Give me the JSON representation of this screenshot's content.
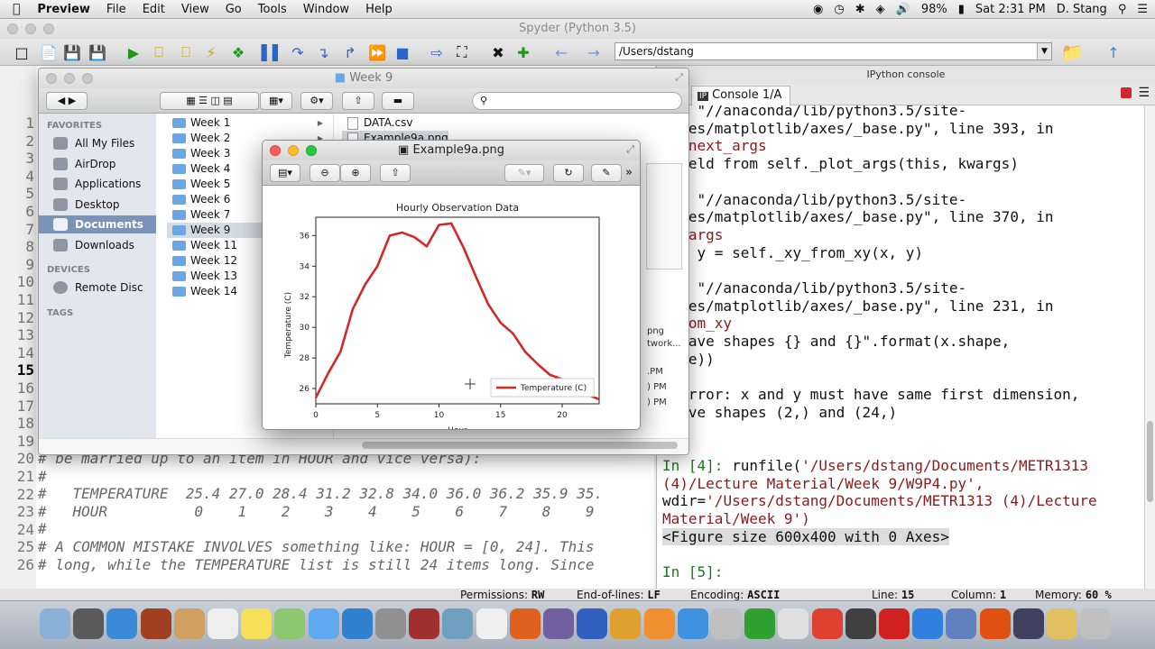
{
  "menubar": {
    "apple": "",
    "app": "Preview",
    "items": [
      "File",
      "Edit",
      "View",
      "Go",
      "Tools",
      "Window",
      "Help"
    ],
    "battery": "98%",
    "clock": "Sat 2:31 PM",
    "user": "D. Stang"
  },
  "spyder": {
    "title": "Spyder (Python 3.5)",
    "path": "/Users/dstang",
    "console_header": "IPython console",
    "console_tab": "Console 1/A"
  },
  "editor": {
    "line_numbers": [
      "1",
      "2",
      "3",
      "4",
      "5",
      "6",
      "7",
      "8",
      "9",
      "10",
      "11",
      "12",
      "13",
      "14",
      "15",
      "16",
      "17",
      "18",
      "19",
      "20",
      "21",
      "22",
      "23",
      "24",
      "25",
      "26"
    ],
    "current_line": "15",
    "code_lines": [
      "# be married up to an item in HOUR and vice versa):",
      "#",
      "#   TEMPERATURE  25.4 27.0 28.4 31.2 32.8 34.0 36.0 36.2 35.9 35.",
      "#   HOUR          0    1    2    3    4    5    6    7    8    9",
      "#",
      "# A COMMON MISTAKE INVOLVES something like: HOUR = [0, 24]. This",
      "# long, while the TEMPERATURE list is still 24 items long. Since"
    ]
  },
  "console": {
    "lines": [
      {
        "t": "ile \"//anaconda/lib/python3.5/site-",
        "c": ""
      },
      {
        "t": "kages/matplotlib/axes/_base.py\", line 393, in",
        "c": ""
      },
      {
        "t": "ab_next_args",
        "c": "str"
      },
      {
        "t": " yield from self._plot_args(this, kwargs)",
        "c": ""
      },
      {
        "t": "",
        "c": ""
      },
      {
        "t": "ile \"//anaconda/lib/python3.5/site-",
        "c": ""
      },
      {
        "t": "kages/matplotlib/axes/_base.py\", line 370, in",
        "c": ""
      },
      {
        "t": "ot_args",
        "c": "str"
      },
      {
        "t": " x, y = self._xy_from_xy(x, y)",
        "c": ""
      },
      {
        "t": "",
        "c": ""
      },
      {
        "t": "ile \"//anaconda/lib/python3.5/site-",
        "c": ""
      },
      {
        "t": "kages/matplotlib/axes/_base.py\", line 231, in",
        "c": ""
      },
      {
        "t": "_from_xy",
        "c": "str"
      },
      {
        "t": " \"have shapes {} and {}\".format(x.shape,",
        "c": ""
      },
      {
        "t": "hape))",
        "c": ""
      },
      {
        "t": "",
        "c": ""
      },
      {
        "t": "ueError: x and y must have same first dimension,",
        "c": ""
      },
      {
        "t": " have shapes (2,) and (24,)",
        "c": ""
      },
      {
        "t": "",
        "c": ""
      },
      {
        "t": "",
        "c": ""
      },
      {
        "t": "In [4]: runfile('/Users/dstang/Documents/METR1313",
        "c": "run"
      },
      {
        "t": "(4)/Lecture Material/Week 9/W9P4.py',",
        "c": "str"
      },
      {
        "t": "wdir='/Users/dstang/Documents/METR1313 (4)/Lecture",
        "c": "wdir"
      },
      {
        "t": "Material/Week 9')",
        "c": "str"
      },
      {
        "t": "<Figure size 600x400 with 0 Axes>",
        "c": "fig"
      },
      {
        "t": "",
        "c": ""
      },
      {
        "t": "In [5]:",
        "c": "in"
      }
    ]
  },
  "statusbar": {
    "permissions_label": "Permissions:",
    "permissions": "RW",
    "eol_label": "End-of-lines:",
    "eol": "LF",
    "encoding_label": "Encoding:",
    "encoding": "ASCII",
    "line_label": "Line:",
    "line": "15",
    "column_label": "Column:",
    "column": "1",
    "memory_label": "Memory:",
    "memory": "60 %"
  },
  "finder": {
    "title": "Week 9",
    "favorites_label": "FAVORITES",
    "favorites": [
      "All My Files",
      "AirDrop",
      "Applications",
      "Desktop",
      "Documents",
      "Downloads"
    ],
    "selected_favorite": "Documents",
    "devices_label": "DEVICES",
    "devices": [
      "Remote Disc"
    ],
    "tags_label": "TAGS",
    "folders": [
      "Week 1",
      "Week 2",
      "Week 3",
      "Week 4",
      "Week 5",
      "Week 6",
      "Week 7",
      "Week 9",
      "Week 11",
      "Week 12",
      "Week 13",
      "Week 14"
    ],
    "selected_folder": "Week 9",
    "files": [
      "DATA.csv",
      "Example9a.png"
    ],
    "partial_text": [
      "png",
      "twork...",
      ".PM",
      ") PM",
      ") PM"
    ]
  },
  "preview": {
    "title": "Example9a.png"
  },
  "chart_data": {
    "type": "line",
    "title": "Hourly Observation Data",
    "xlabel": "Hour",
    "ylabel": "Temperature (C)",
    "xlim": [
      0,
      23
    ],
    "ylim": [
      25,
      37.2
    ],
    "xticks": [
      0,
      5,
      10,
      15,
      20
    ],
    "yticks": [
      26,
      28,
      30,
      32,
      34,
      36
    ],
    "grid": false,
    "legend": "lower right",
    "series": [
      {
        "name": "Temperature (C)",
        "color": "#d62728",
        "x": [
          0,
          1,
          2,
          3,
          4,
          5,
          6,
          7,
          8,
          9,
          10,
          11,
          12,
          13,
          14,
          15,
          16,
          17,
          18,
          19,
          20,
          21,
          22,
          23
        ],
        "y": [
          25.4,
          27.0,
          28.4,
          31.2,
          32.8,
          34.0,
          36.0,
          36.2,
          35.9,
          35.3,
          36.7,
          36.8,
          35.2,
          33.3,
          31.5,
          30.3,
          29.6,
          28.4,
          27.6,
          26.9,
          26.6,
          25.9,
          25.6,
          25.3
        ]
      }
    ]
  }
}
